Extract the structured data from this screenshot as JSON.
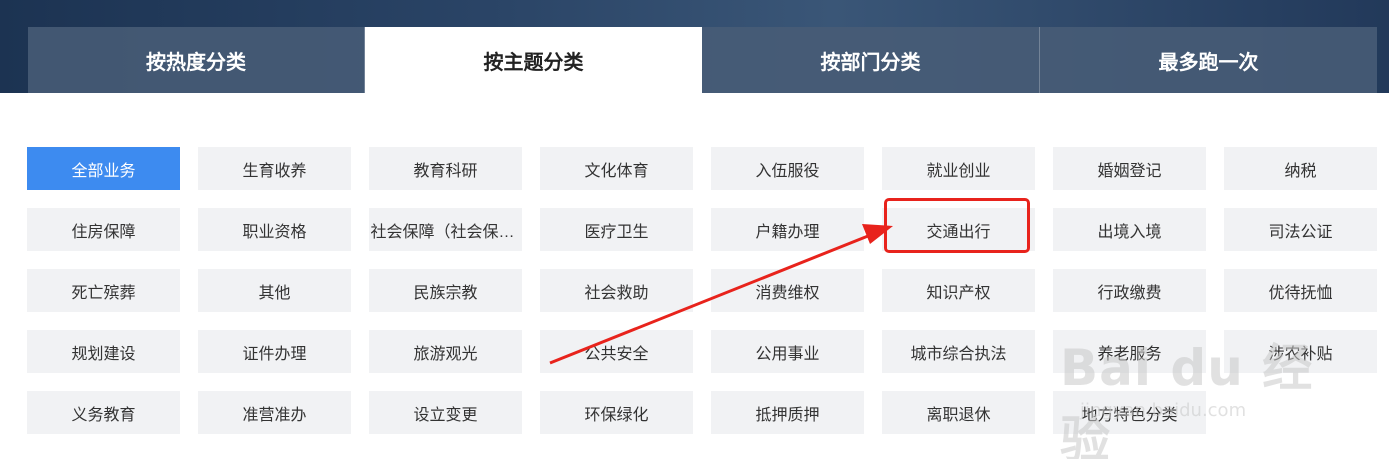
{
  "tabs": [
    {
      "label": "按热度分类",
      "active": false
    },
    {
      "label": "按主题分类",
      "active": true
    },
    {
      "label": "按部门分类",
      "active": false
    },
    {
      "label": "最多跑一次",
      "active": false
    }
  ],
  "categories": [
    "全部业务",
    "生育收养",
    "教育科研",
    "文化体育",
    "入伍服役",
    "就业创业",
    "婚姻登记",
    "纳税",
    "住房保障",
    "职业资格",
    "社会保障（社会保险）",
    "医疗卫生",
    "户籍办理",
    "交通出行",
    "出境入境",
    "司法公证",
    "死亡殡葬",
    "其他",
    "民族宗教",
    "社会救助",
    "消费维权",
    "知识产权",
    "行政缴费",
    "优待抚恤",
    "规划建设",
    "证件办理",
    "旅游观光",
    "公共安全",
    "公用事业",
    "城市综合执法",
    "养老服务",
    "涉农补贴",
    "义务教育",
    "准营准办",
    "设立变更",
    "环保绿化",
    "抵押质押",
    "离职退休",
    "地方特色分类"
  ],
  "active_category": "全部业务",
  "highlighted_category": "交通出行",
  "colors": {
    "accent": "#3d8bf0",
    "annotation": "#e8231c",
    "cell_bg": "#f1f2f4"
  },
  "watermark": {
    "logo": "Bai du 经验",
    "sub": "jingyan.baidu.com"
  }
}
